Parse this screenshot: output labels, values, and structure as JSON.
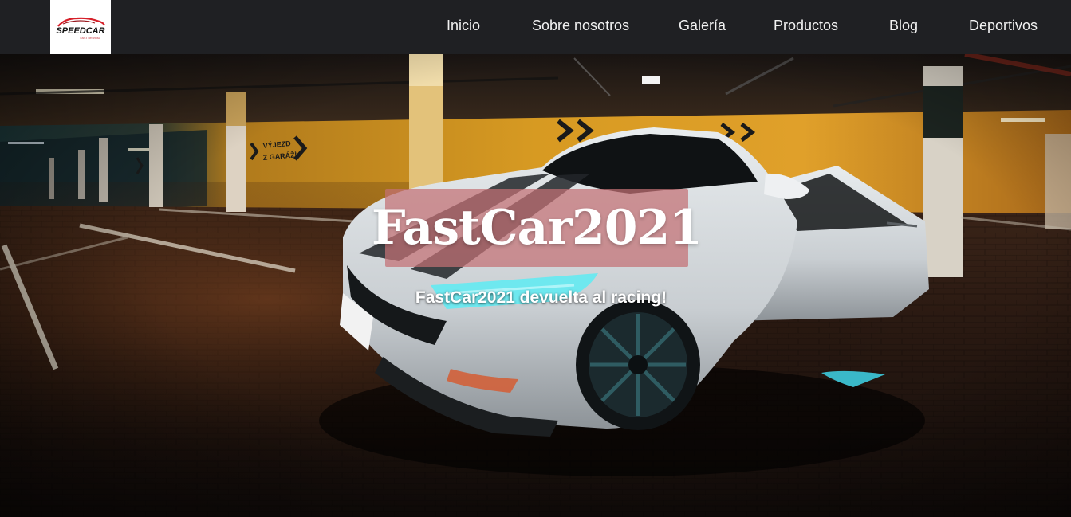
{
  "brand": {
    "logo_alt": "SpeedCar",
    "logo_text": "SPEEDCAR",
    "logo_tagline": "FAST DRIVING"
  },
  "nav": {
    "items": [
      {
        "label": "Inicio"
      },
      {
        "label": "Sobre nosotros"
      },
      {
        "label": "Galería"
      },
      {
        "label": "Productos"
      },
      {
        "label": "Blog"
      },
      {
        "label": "Deportivos"
      }
    ]
  },
  "hero": {
    "title": "FastCar2021",
    "subtitle": "FastCar2021 devuelta al racing!",
    "wall_sign": "VÝJEZD\nZ GARÁŽÍ"
  },
  "colors": {
    "navbar_bg": "#1f2023",
    "title_box": "#c47075",
    "nav_text": "#f2f2f2"
  }
}
